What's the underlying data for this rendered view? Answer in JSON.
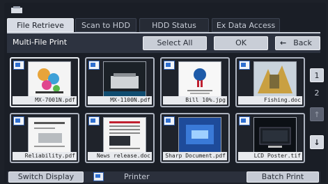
{
  "tabs": [
    {
      "label": "File Retrieve",
      "active": true
    },
    {
      "label": "Scan to HDD",
      "active": false
    },
    {
      "label": "HDD Status",
      "active": false
    },
    {
      "label": "Ex Data Access",
      "active": false
    }
  ],
  "header": {
    "title": "Multi-File Print",
    "select_all": "Select All",
    "ok": "OK",
    "back": "Back"
  },
  "files": [
    {
      "name": "MX-7001N.pdf",
      "selected": true,
      "thumb": "poster"
    },
    {
      "name": "MX-1100N.pdf",
      "selected": false,
      "thumb": "dark-machine"
    },
    {
      "name": "Bill 10%.jpg",
      "selected": false,
      "thumb": "certificate"
    },
    {
      "name": "Fishing.doc",
      "selected": false,
      "thumb": "photo"
    },
    {
      "name": "Reliability.pdf",
      "selected": false,
      "thumb": "document"
    },
    {
      "name": "News release.doc",
      "selected": false,
      "thumb": "brochure"
    },
    {
      "name": "Sharp Document.pdf",
      "selected": false,
      "thumb": "blue-cover"
    },
    {
      "name": "LCD Poster.tif",
      "selected": false,
      "thumb": "dark-cover"
    }
  ],
  "paging": {
    "page1": "1",
    "page2": "2"
  },
  "footer": {
    "switch_display": "Switch Display",
    "printer": "Printer",
    "batch_print": "Batch Print"
  }
}
